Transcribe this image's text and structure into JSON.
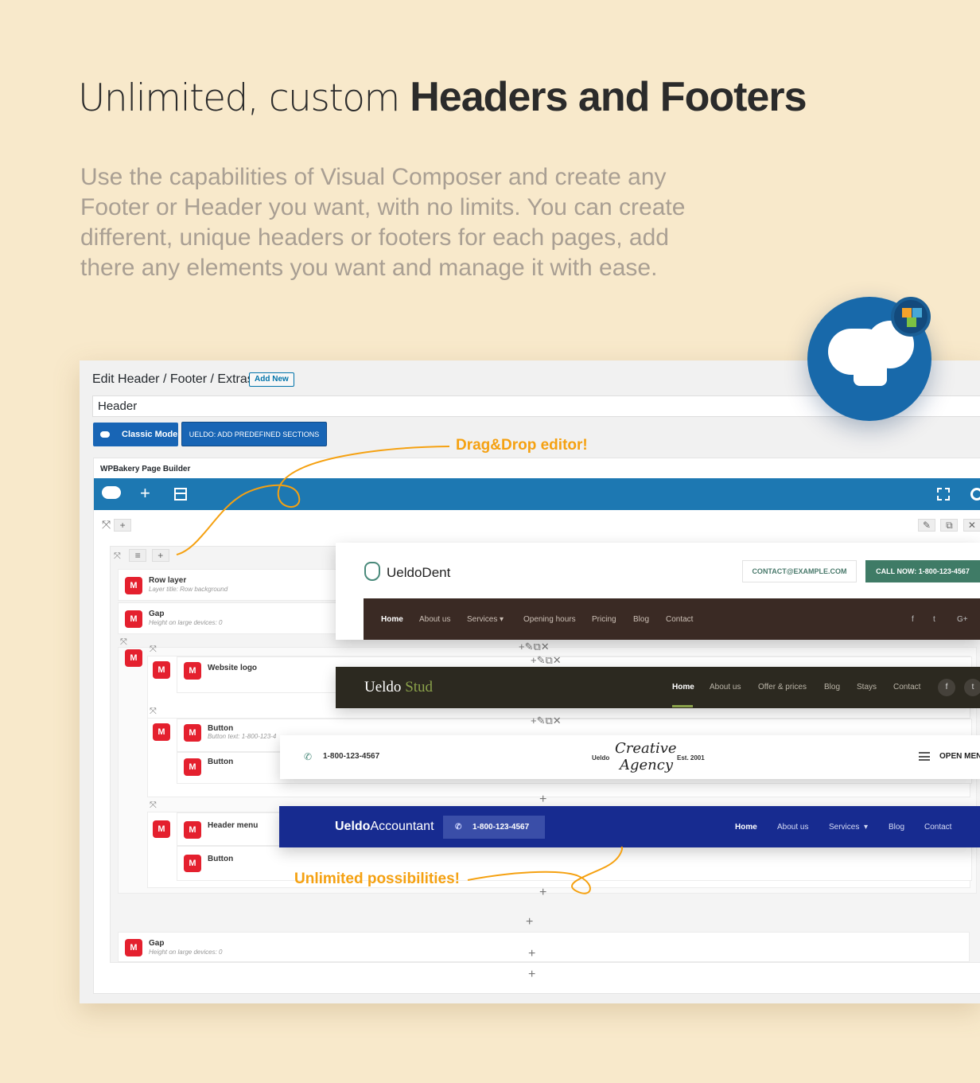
{
  "hero": {
    "title_light": "Unlimited, custom ",
    "title_bold": "Headers and Footers",
    "description": "Use the capabilities of Visual Composer and create any Footer or Header you want, with no limits. You can create different, unique headers or footers for each pages, add there any elements you want and manage it with ease."
  },
  "editor": {
    "title": "Edit Header / Footer / Extras",
    "add_new": "Add New",
    "post_title": "Header",
    "classic_mode": "Classic Mode",
    "predefined": "UELDO: ADD PREDEFINED SECTIONS",
    "builder_label": "WPBakery Page Builder"
  },
  "elements": {
    "row_layer": "Row layer",
    "row_layer_sub": "Layer title: Row background",
    "gap": "Gap",
    "gap_sub": "Height on large devices: 0",
    "website_logo": "Website logo",
    "button": "Button",
    "button_sub": "Button text: 1-800-123-4",
    "header_menu": "Header menu",
    "badge": "M"
  },
  "annotations": {
    "drag_drop": "Drag&Drop editor!",
    "unlimited": "Unlimited possibilities!"
  },
  "dent": {
    "logo": "UeldoDent",
    "email": "CONTACT@EXAMPLE.COM",
    "call": "CALL NOW: 1-800-123-4567",
    "nav": [
      "Home",
      "About us",
      "Services",
      "Opening hours",
      "Pricing",
      "Blog",
      "Contact"
    ],
    "social": [
      "f",
      "t",
      "G+"
    ]
  },
  "stud": {
    "logo_a": "Ueldo",
    "logo_b": "Stud",
    "nav": [
      "Home",
      "About us",
      "Offer & prices",
      "Blog",
      "Stays",
      "Contact"
    ],
    "social": [
      "f",
      "t"
    ]
  },
  "creative": {
    "phone": "1-800-123-4567",
    "left_small": "Ueldo",
    "big_line1": "Creative",
    "big_line2": "Agency",
    "right_small": "Est. 2001",
    "open_menu": "OPEN MENU"
  },
  "accountant": {
    "logo_bold": "Ueldo",
    "logo_rest": "Accountant",
    "phone": "1-800-123-4567",
    "nav": [
      "Home",
      "About us",
      "Services",
      "Blog",
      "Contact"
    ]
  },
  "colors": {
    "background": "#f8e9cb",
    "wpb_blue": "#1d78b2",
    "annotation": "#f5a111",
    "badge_red": "#e4202e",
    "dent_green": "#3f7b66",
    "accountant_blue": "#172b90"
  }
}
